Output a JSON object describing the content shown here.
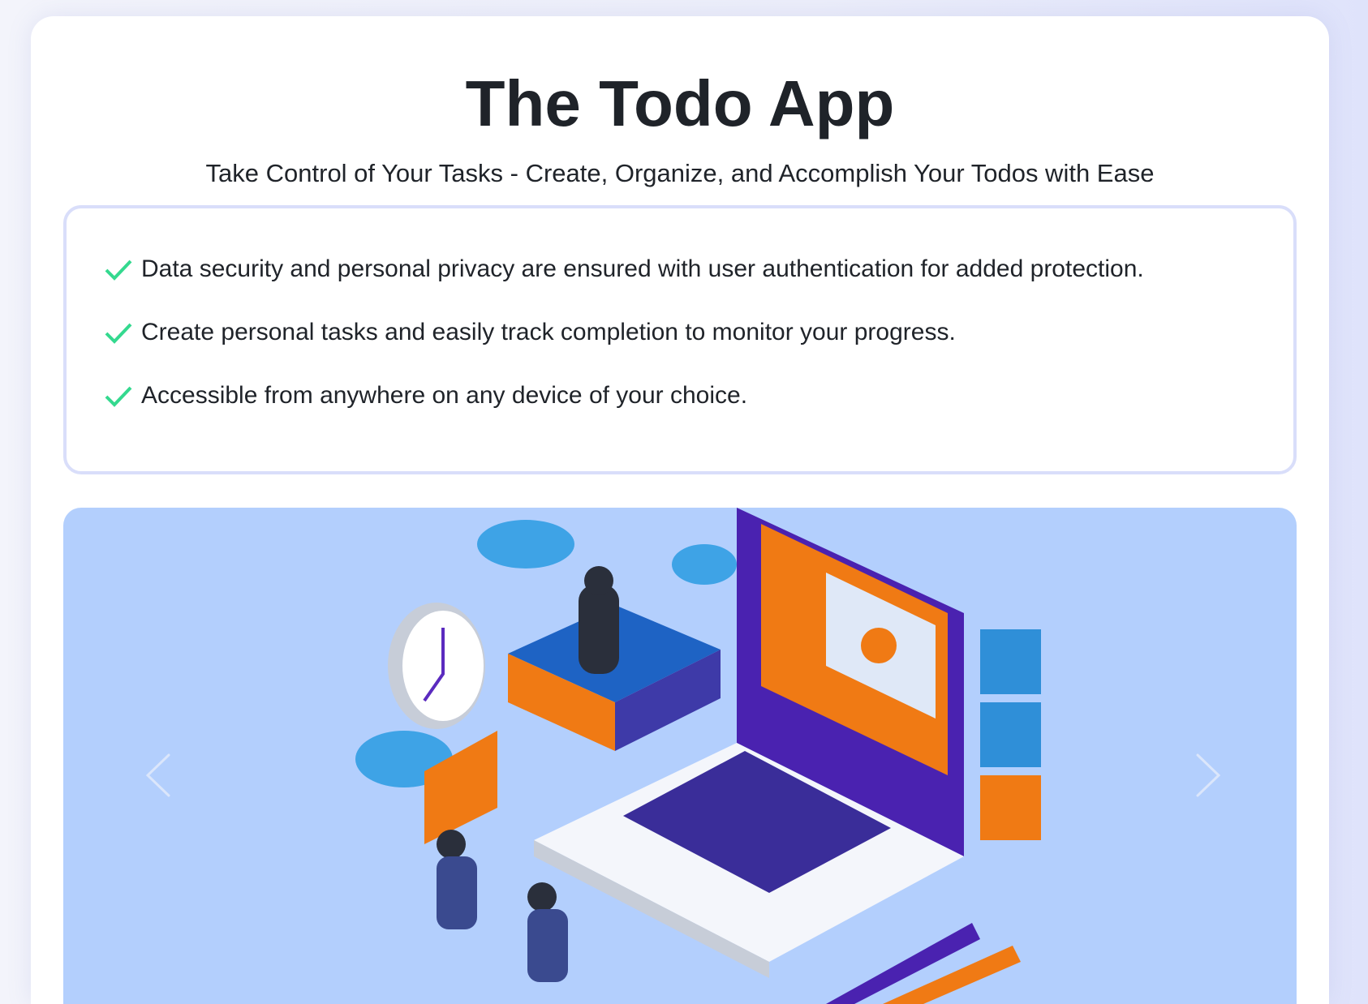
{
  "header": {
    "title": "The Todo App",
    "subtitle": "Take Control of Your Tasks - Create, Organize, and Accomplish Your Todos with Ease"
  },
  "features": [
    {
      "icon": "check-icon",
      "text": "Data security and personal privacy are ensured with user authentication for added protection."
    },
    {
      "icon": "check-icon",
      "text": "Create personal tasks and easily track completion to monitor your progress."
    },
    {
      "icon": "check-icon",
      "text": "Accessible from anywhere on any device of your choice."
    }
  ],
  "carousel": {
    "prev_icon": "chevron-left-icon",
    "next_icon": "chevron-right-icon",
    "background": "#b3cffd"
  },
  "colors": {
    "check": "#34d98f",
    "text": "#1f2329",
    "border": "#d9defa"
  }
}
